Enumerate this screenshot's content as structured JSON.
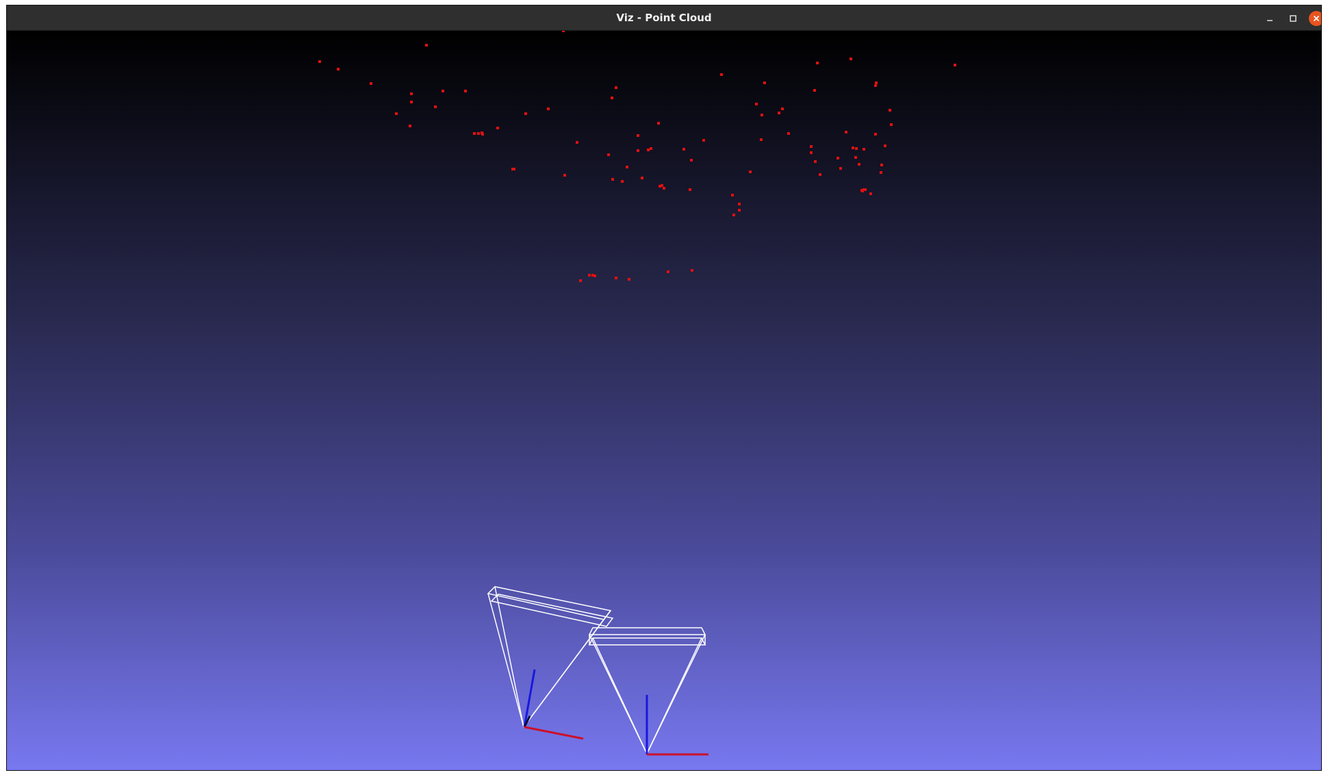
{
  "window": {
    "title": "Viz - Point Cloud"
  },
  "icons": {
    "minimize": "minimize-icon",
    "maximize": "maximize-icon",
    "close": "close-icon"
  },
  "colors": {
    "background_top": "#000000",
    "background_bottom": "#7878f0",
    "points": "#e01010",
    "camera_frustum": "#ffffff",
    "axis_x": "#cc1028",
    "axis_z": "#1818dd"
  },
  "scene": {
    "point_count": 92,
    "cameras": 2
  }
}
